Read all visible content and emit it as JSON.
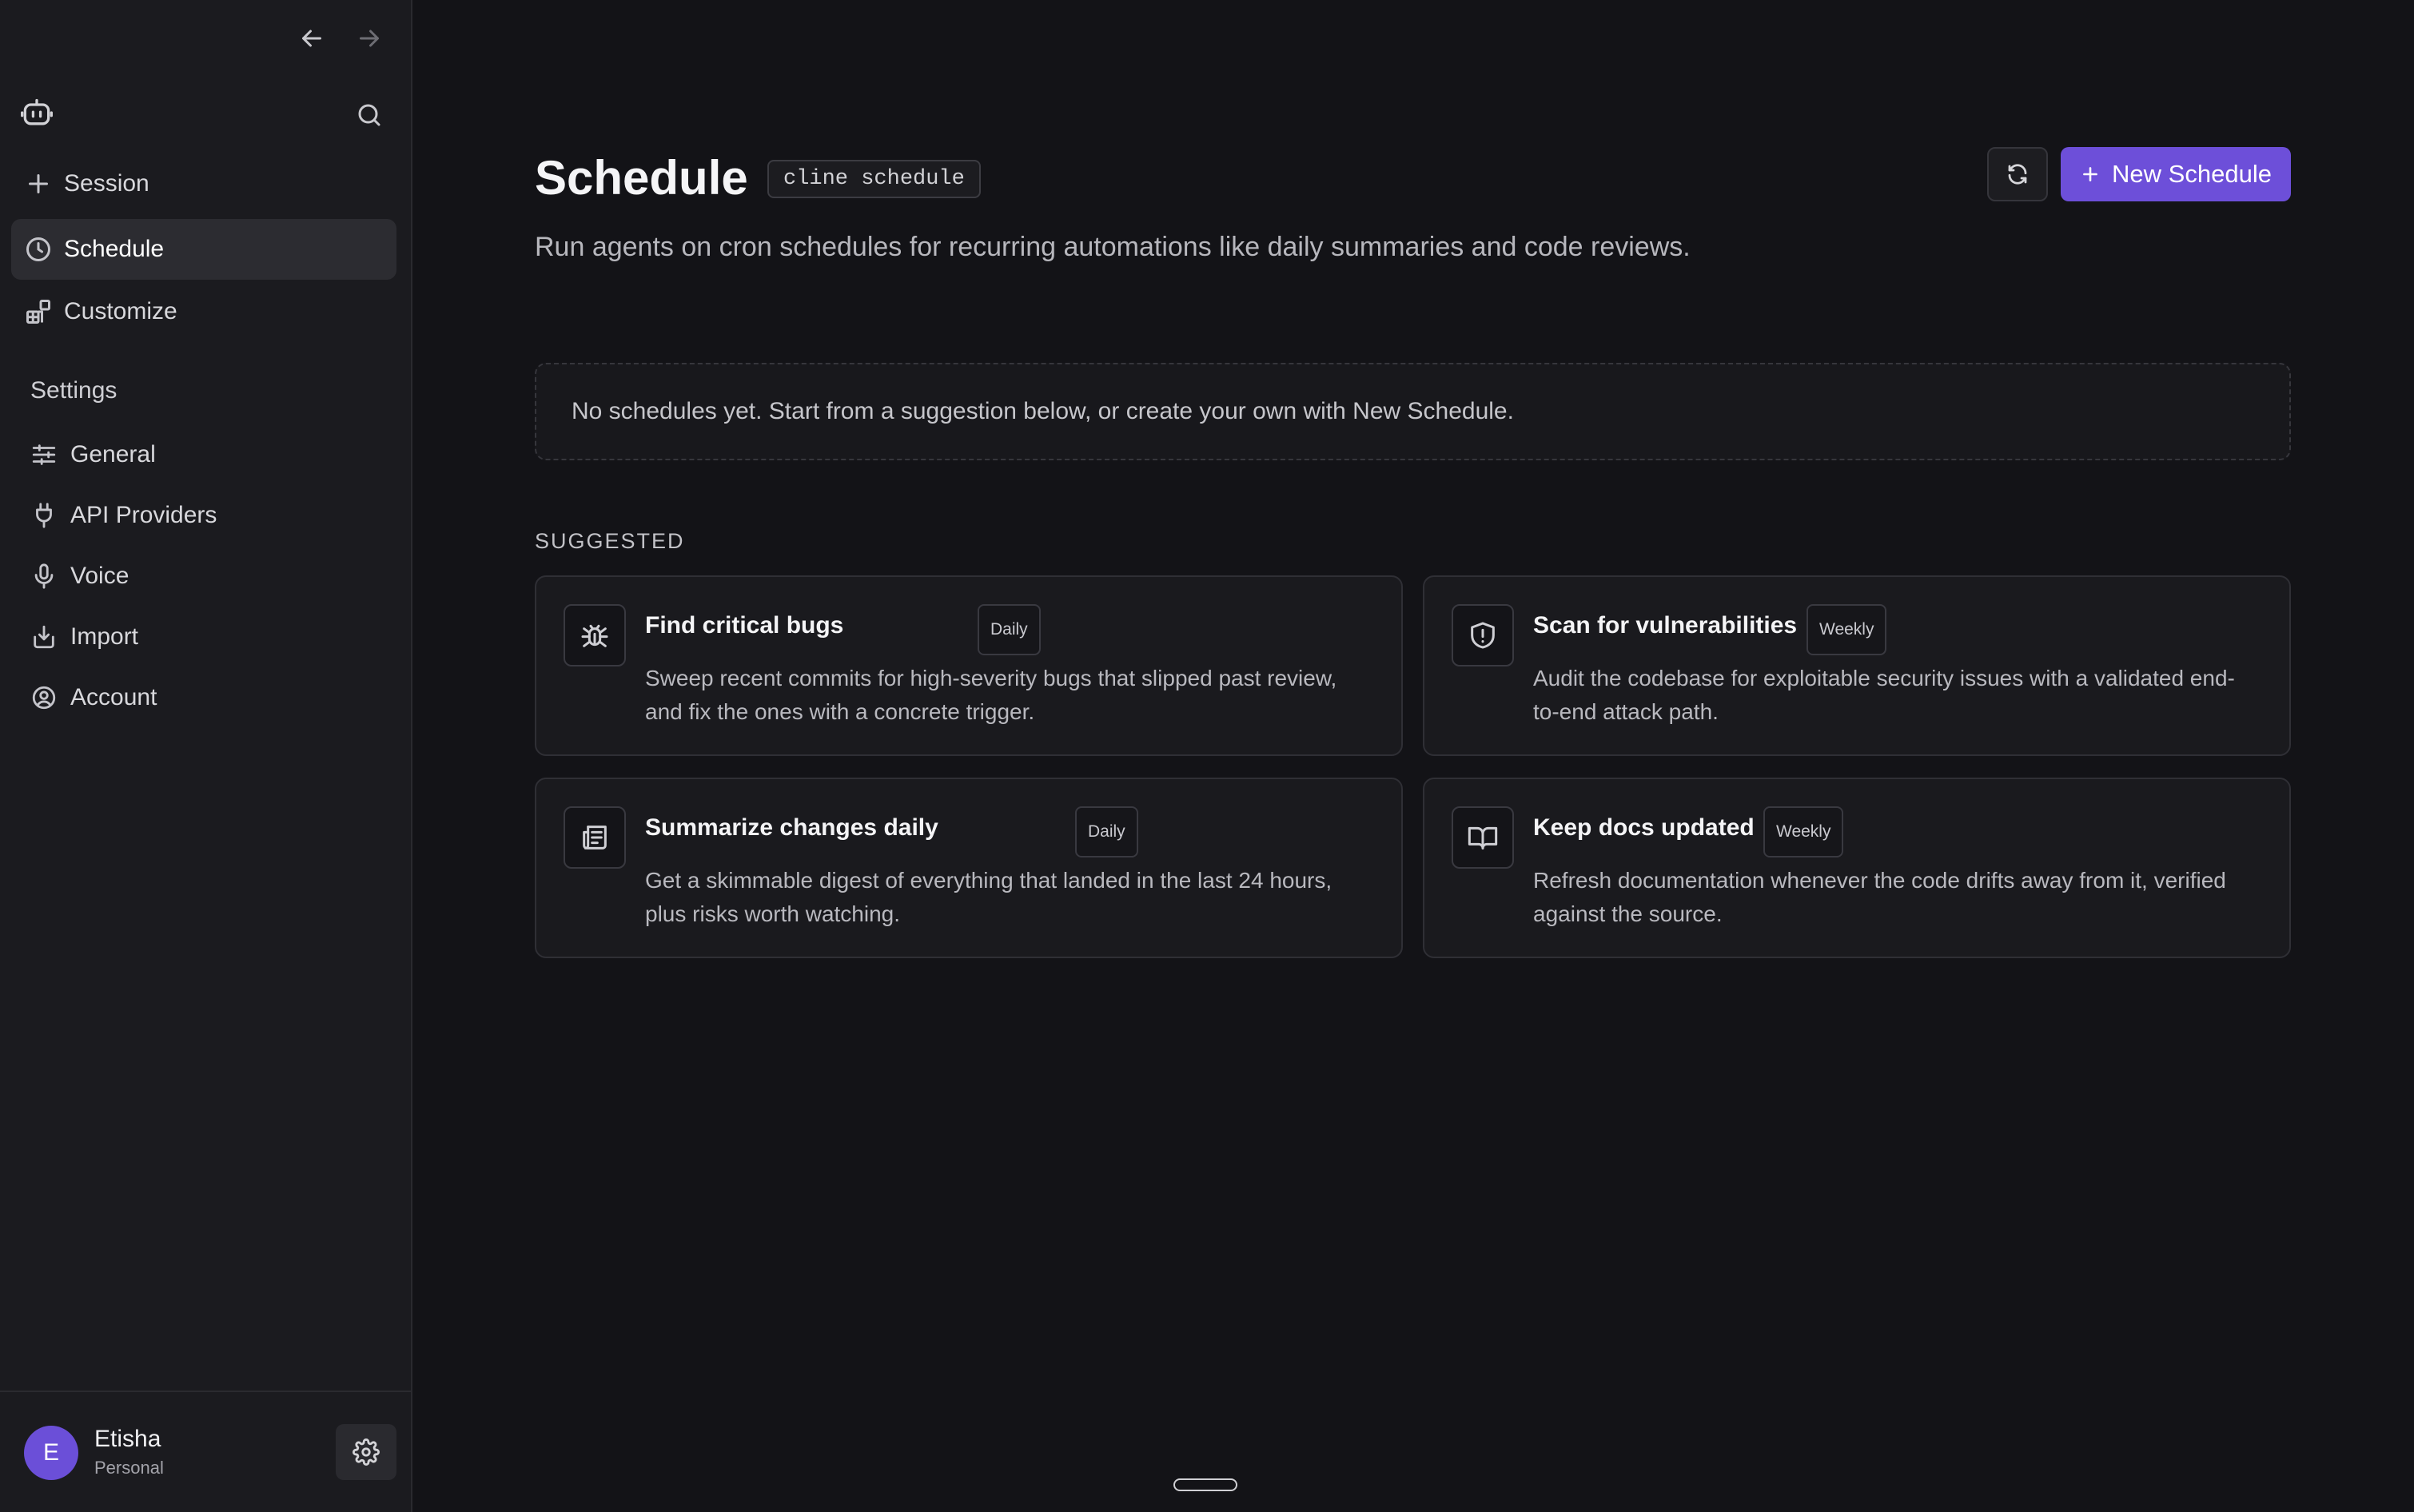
{
  "sidebar": {
    "nav": [
      {
        "label": "Session",
        "icon": "plus-icon",
        "active": false
      },
      {
        "label": "Schedule",
        "icon": "clock-icon",
        "active": true
      },
      {
        "label": "Customize",
        "icon": "widgets-icon",
        "active": false
      }
    ],
    "settings_heading": "Settings",
    "settings": [
      {
        "label": "General",
        "icon": "sliders-icon"
      },
      {
        "label": "API Providers",
        "icon": "plug-icon"
      },
      {
        "label": "Voice",
        "icon": "microphone-icon"
      },
      {
        "label": "Import",
        "icon": "import-icon"
      },
      {
        "label": "Account",
        "icon": "user-circle-icon"
      }
    ],
    "user": {
      "initial": "E",
      "name": "Etisha",
      "plan": "Personal"
    }
  },
  "main": {
    "title": "Schedule",
    "command_chip": "cline schedule",
    "new_button_label": "New Schedule",
    "subtitle": "Run agents on cron schedules for recurring automations like daily summaries and code reviews.",
    "empty_message": "No schedules yet. Start from a suggestion below, or create your own with New Schedule.",
    "suggested_label": "SUGGESTED",
    "suggestions": [
      {
        "title": "Find critical bugs",
        "badge": "Daily",
        "icon": "bug-icon",
        "description": "Sweep recent commits for high-severity bugs that slipped past review, and fix the ones with a concrete trigger."
      },
      {
        "title": "Scan for vulnerabilities",
        "badge": "Weekly",
        "icon": "shield-alert-icon",
        "description": "Audit the codebase for exploitable security issues with a validated end-to-end attack path."
      },
      {
        "title": "Summarize changes daily",
        "badge": "Daily",
        "icon": "newspaper-icon",
        "description": "Get a skimmable digest of everything that landed in the last 24 hours, plus risks worth watching."
      },
      {
        "title": "Keep docs updated",
        "badge": "Weekly",
        "icon": "book-open-icon",
        "description": "Refresh documentation whenever the code drifts away from it, verified against the source."
      }
    ]
  },
  "colors": {
    "accent": "#6d4fd9",
    "background": "#131317",
    "sidebar": "#1b1b1f"
  }
}
